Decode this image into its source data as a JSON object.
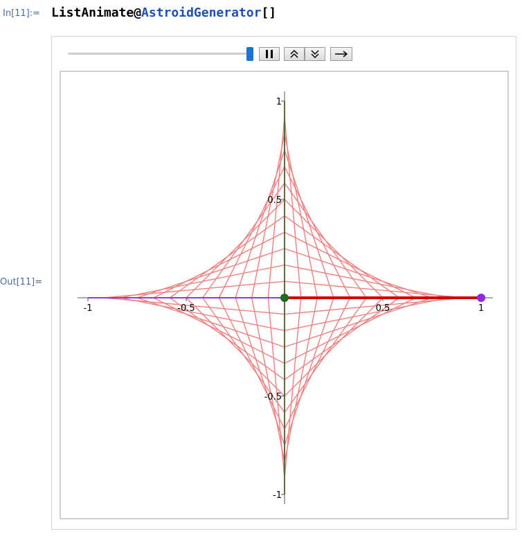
{
  "cell": {
    "in_label": "In[11]:=",
    "out_label": "Out[11]=",
    "code_parts": [
      "ListAnimate@",
      "AstroidGenerator",
      "[]"
    ]
  },
  "controls": {
    "slider_fraction": 1.0,
    "buttons": [
      "pause-icon",
      "step-back-icon",
      "step-forward-icon",
      "direction-icon"
    ]
  },
  "chart_data": {
    "type": "line",
    "title": "",
    "xlabel": "",
    "ylabel": "",
    "xlim": [
      -1,
      1
    ],
    "ylim": [
      -1,
      1
    ],
    "x_ticks": [
      "-1",
      "-0.5",
      "0.5",
      "1"
    ],
    "y_ticks": [
      "1",
      "0.5",
      "-0.5",
      "-1"
    ],
    "x_tick_values": [
      -1,
      -0.5,
      0.5,
      1
    ],
    "y_tick_values": [
      1,
      0.5,
      -0.5,
      -1
    ],
    "envelope_segments": 12,
    "colors": {
      "envelope": "#f08080",
      "red_bar": "#d20000",
      "green": "#1e6b1e",
      "purple": "#8a2be2",
      "vertical_line": "#3a5a28"
    },
    "points": [
      {
        "name": "green-point",
        "x": 0,
        "y": 0
      },
      {
        "name": "purple-point",
        "x": 1,
        "y": 0
      }
    ]
  }
}
